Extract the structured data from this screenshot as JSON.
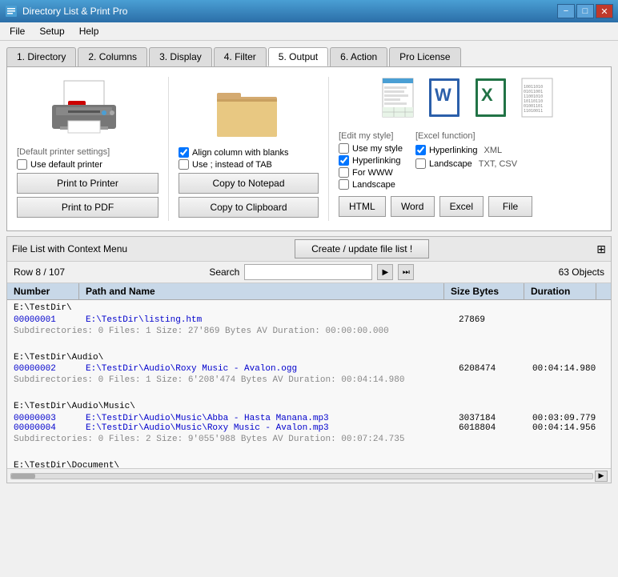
{
  "window": {
    "title": "Directory List & Print Pro",
    "icon": "📁"
  },
  "titlebar": {
    "minimize": "−",
    "restore": "□",
    "close": "✕"
  },
  "menu": {
    "items": [
      "File",
      "Setup",
      "Help"
    ]
  },
  "tabs": [
    {
      "id": "directory",
      "label": "1. Directory"
    },
    {
      "id": "columns",
      "label": "2. Columns"
    },
    {
      "id": "display",
      "label": "3. Display"
    },
    {
      "id": "filter",
      "label": "4. Filter"
    },
    {
      "id": "output",
      "label": "5. Output",
      "active": true
    },
    {
      "id": "action",
      "label": "6. Action"
    },
    {
      "id": "pro",
      "label": "Pro License"
    }
  ],
  "output": {
    "printer_section": {
      "label_default": "[Default printer settings]",
      "checkbox_default": "Use default printer",
      "btn_print": "Print to Printer",
      "btn_pdf": "Print to PDF"
    },
    "clipboard_section": {
      "checkbox_align": "Align column with blanks",
      "checkbox_semicolon": "Use ;  instead of TAB",
      "btn_notepad": "Copy to Notepad",
      "btn_clipboard": "Copy to Clipboard"
    },
    "format_section": {
      "label_edit": "[Edit my style]",
      "checkbox_mystyle": "Use my style",
      "checkbox_hyper_left": "Hyperlinking",
      "checkbox_forwww": "For WWW",
      "checkbox_landscape_left": "Landscape",
      "label_excel": "[Excel function]",
      "checkbox_hyper_right": "Hyperlinking",
      "label_xml": "XML",
      "checkbox_landscape_right": "Landscape",
      "label_txtcsv": "TXT, CSV",
      "btn_html": "HTML",
      "btn_word": "Word",
      "btn_excel": "Excel",
      "btn_file": "File"
    }
  },
  "bottom": {
    "context_menu_label": "File List with Context Menu",
    "create_btn": "Create / update file list !",
    "tools_icon": "⊞",
    "row_info": "Row 8 / 107",
    "search_label": "Search",
    "search_placeholder": "",
    "objects_count": "63 Objects",
    "table": {
      "headers": [
        "Number",
        "Path and Name",
        "Size Bytes",
        "Duration"
      ],
      "rows": [
        {
          "type": "dir",
          "text": "E:\\TestDir\\"
        },
        {
          "type": "entry",
          "number": "00000001",
          "path": "E:\\TestDir\\listing.htm",
          "size": "27869",
          "duration": ""
        },
        {
          "type": "subinfo",
          "text": "Subdirectories: 0     Files: 1     Size: 27'869 Bytes     AV Duration: 00:00:00.000"
        },
        {
          "type": "separator"
        },
        {
          "type": "dir",
          "text": "E:\\TestDir\\Audio\\"
        },
        {
          "type": "entry",
          "number": "00000002",
          "path": "E:\\TestDir\\Audio\\Roxy Music - Avalon.ogg",
          "size": "6208474",
          "duration": "00:04:14.980"
        },
        {
          "type": "subinfo",
          "text": "Subdirectories: 0     Files: 1     Size: 6'208'474 Bytes     AV Duration: 00:04:14.980"
        },
        {
          "type": "separator"
        },
        {
          "type": "dir",
          "text": "E:\\TestDir\\Audio\\Music\\"
        },
        {
          "type": "entry",
          "number": "00000003",
          "path": "E:\\TestDir\\Audio\\Music\\Abba - Hasta Manana.mp3",
          "size": "3037184",
          "duration": "00:03:09.779"
        },
        {
          "type": "entry2",
          "number": "00000004",
          "path": "E:\\TestDir\\Audio\\Music\\Roxy Music - Avalon.mp3",
          "size": "6018804",
          "duration": "00:04:14.956"
        },
        {
          "type": "subinfo",
          "text": "Subdirectories: 0     Files: 2     Size: 9'055'988 Bytes     AV Duration: 00:07:24.735"
        },
        {
          "type": "separator"
        },
        {
          "type": "dir",
          "text": "E:\\TestDir\\Document\\"
        }
      ]
    }
  }
}
